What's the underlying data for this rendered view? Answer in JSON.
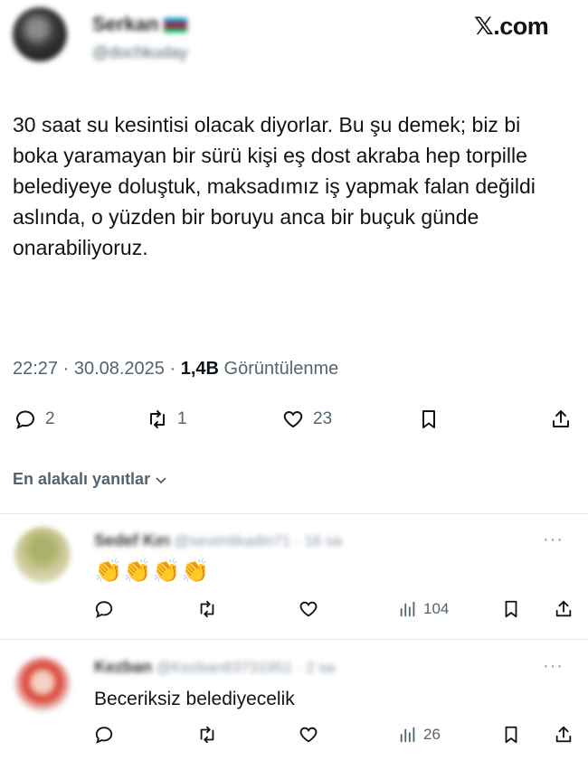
{
  "author": {
    "display_name": "Serkan",
    "handle": "@dochkuday",
    "avatar_icon": "avatar-icon",
    "flag_icon": "azerbaijan-flag-icon"
  },
  "brand": "𝕏.com",
  "tweet": {
    "text": "30 saat su kesintisi olacak diyorlar. Bu şu demek; biz bi boka yaramayan bir sürü kişi eş dost akraba hep torpille belediyeye doluştuk, maksadımız iş yapmak falan değildi aslında, o yüzden bir boruyu anca bir buçuk günde onarabiliyoruz.",
    "time": "22:27 · 30.08.2025 · ",
    "views": "1,4B",
    "views_label": " Görüntülenme",
    "replies": "2",
    "retweets": "1",
    "likes": "23"
  },
  "sort_label": "En alakalı yanıtlar",
  "replies": [
    {
      "name": "Sedef Kırı",
      "handle": "@sevimlikadin71 · 16 sa",
      "text": "👏👏👏👏",
      "views": "104"
    },
    {
      "name": "Kezban",
      "handle": "@Kezban83731951 · 2 sa",
      "text": "Beceriksiz belediyecelik",
      "views": "26"
    }
  ],
  "colors": {
    "text": "#0f1419",
    "muted": "#536471",
    "divider": "#e6e6e6"
  }
}
